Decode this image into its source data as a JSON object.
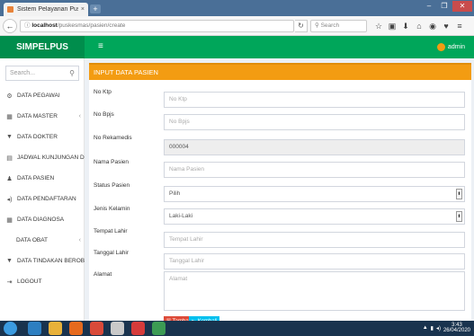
{
  "browser": {
    "tab_title": "Sistem Pelayanan Puskesm...",
    "tab_close": "×",
    "url_host": "localhost",
    "url_path": "/puskesmas/pasien/create",
    "search_placeholder": "Search"
  },
  "app": {
    "brand": "SIMPELPUS",
    "menu_toggle": "≡",
    "user": "admin"
  },
  "sidebar": {
    "search_placeholder": "Search...",
    "items": [
      {
        "label": "DATA PEGAWAI",
        "icon": "user-circle-icon",
        "glyph": "⚙",
        "chevron": ""
      },
      {
        "label": "DATA MASTER",
        "icon": "table-icon",
        "glyph": "▦",
        "chevron": "‹"
      },
      {
        "label": "DATA DOKTER",
        "icon": "filter-icon",
        "glyph": "▼",
        "chevron": ""
      },
      {
        "label": "JADWAL KUNJUNGAN DOKTER",
        "icon": "calendar-icon",
        "glyph": "▤",
        "chevron": ""
      },
      {
        "label": "DATA PASIEN",
        "icon": "user-icon",
        "glyph": "♟",
        "chevron": ""
      },
      {
        "label": "DATA PENDAFTARAN",
        "icon": "volume-icon",
        "glyph": "◂)",
        "chevron": ""
      },
      {
        "label": "DATA DIAGNOSA",
        "icon": "table-icon",
        "glyph": "▦",
        "chevron": ""
      },
      {
        "label": "DATA OBAT",
        "icon": "",
        "glyph": "",
        "chevron": "‹"
      },
      {
        "label": "DATA TINDAKAN BEROBAT",
        "icon": "filter-icon",
        "glyph": "▼",
        "chevron": ""
      },
      {
        "label": "LOGOUT",
        "icon": "signout-icon",
        "glyph": "⇥",
        "chevron": ""
      }
    ]
  },
  "form": {
    "title": "INPUT DATA PASIEN",
    "fields": [
      {
        "label": "No Ktp",
        "placeholder": "No Ktp"
      },
      {
        "label": "No Bpjs",
        "placeholder": "No Bpjs"
      },
      {
        "label": "No Rekamedis",
        "value": "000004"
      },
      {
        "label": "Nama Pasien",
        "placeholder": "Nama Pasien"
      },
      {
        "label": "Status Pasien",
        "value": "Pilih"
      },
      {
        "label": "Jenis Kelamin",
        "value": "Laki-Laki"
      },
      {
        "label": "Tempat Lahir",
        "placeholder": "Tempat Lahir"
      },
      {
        "label": "Tanggal Lahir",
        "placeholder": "Tanggal Lahir"
      },
      {
        "label": "Alamat",
        "placeholder": "Alamat"
      }
    ],
    "buttons": {
      "save": "Tambah",
      "back": "Kembali"
    }
  },
  "taskbar": {
    "time": "3:43",
    "date": "26/04/2020"
  },
  "colors": {
    "header_green": "#00a65a",
    "brand_green": "#008d4c",
    "box_orange": "#f39c12",
    "btn_red": "#dd4b39",
    "btn_blue": "#00c0ef"
  }
}
